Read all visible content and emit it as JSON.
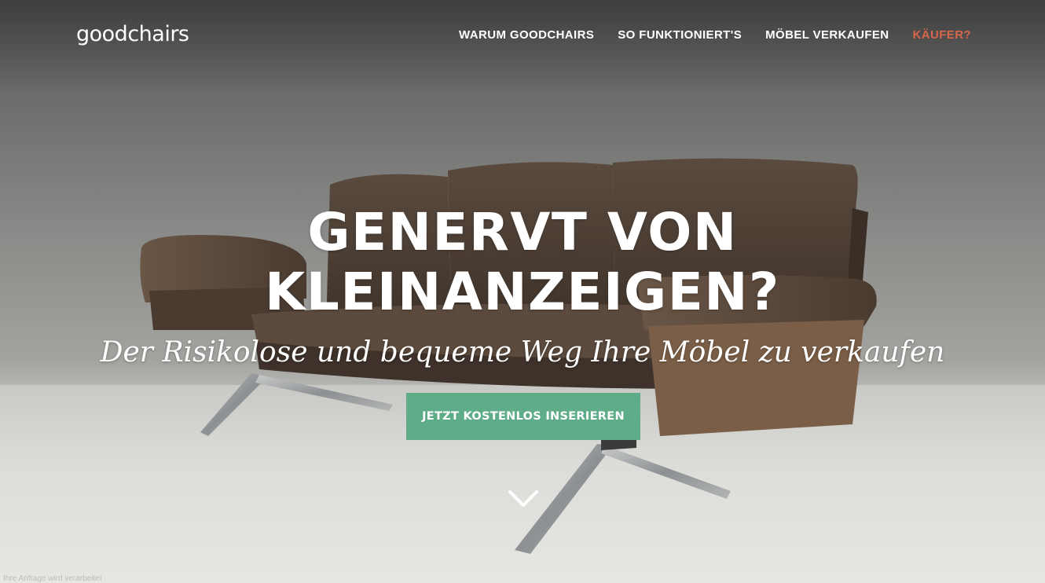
{
  "brand": {
    "name": "goodchairs"
  },
  "nav": {
    "items": [
      {
        "label": "WARUM GOODCHAIRS"
      },
      {
        "label": "SO FUNKTIONIERT'S"
      },
      {
        "label": "MÖBEL VERKAUFEN"
      },
      {
        "label": "KÄUFER?"
      }
    ]
  },
  "hero": {
    "headline_line1": "GENERVT VON",
    "headline_line2": "KLEINANZEIGEN?",
    "subheadline": "Der Risikolose und bequeme Weg Ihre Möbel zu verkaufen",
    "cta_label": "JETZT KOSTENLOS INSERIEREN",
    "scroll_icon": "chevron-down-icon"
  },
  "status_bar": {
    "text": "Ihre Anfrage wird verarbeitet"
  },
  "colors": {
    "accent_nav": "#d9654a",
    "cta_background": "#5fac89",
    "text": "#ffffff"
  }
}
